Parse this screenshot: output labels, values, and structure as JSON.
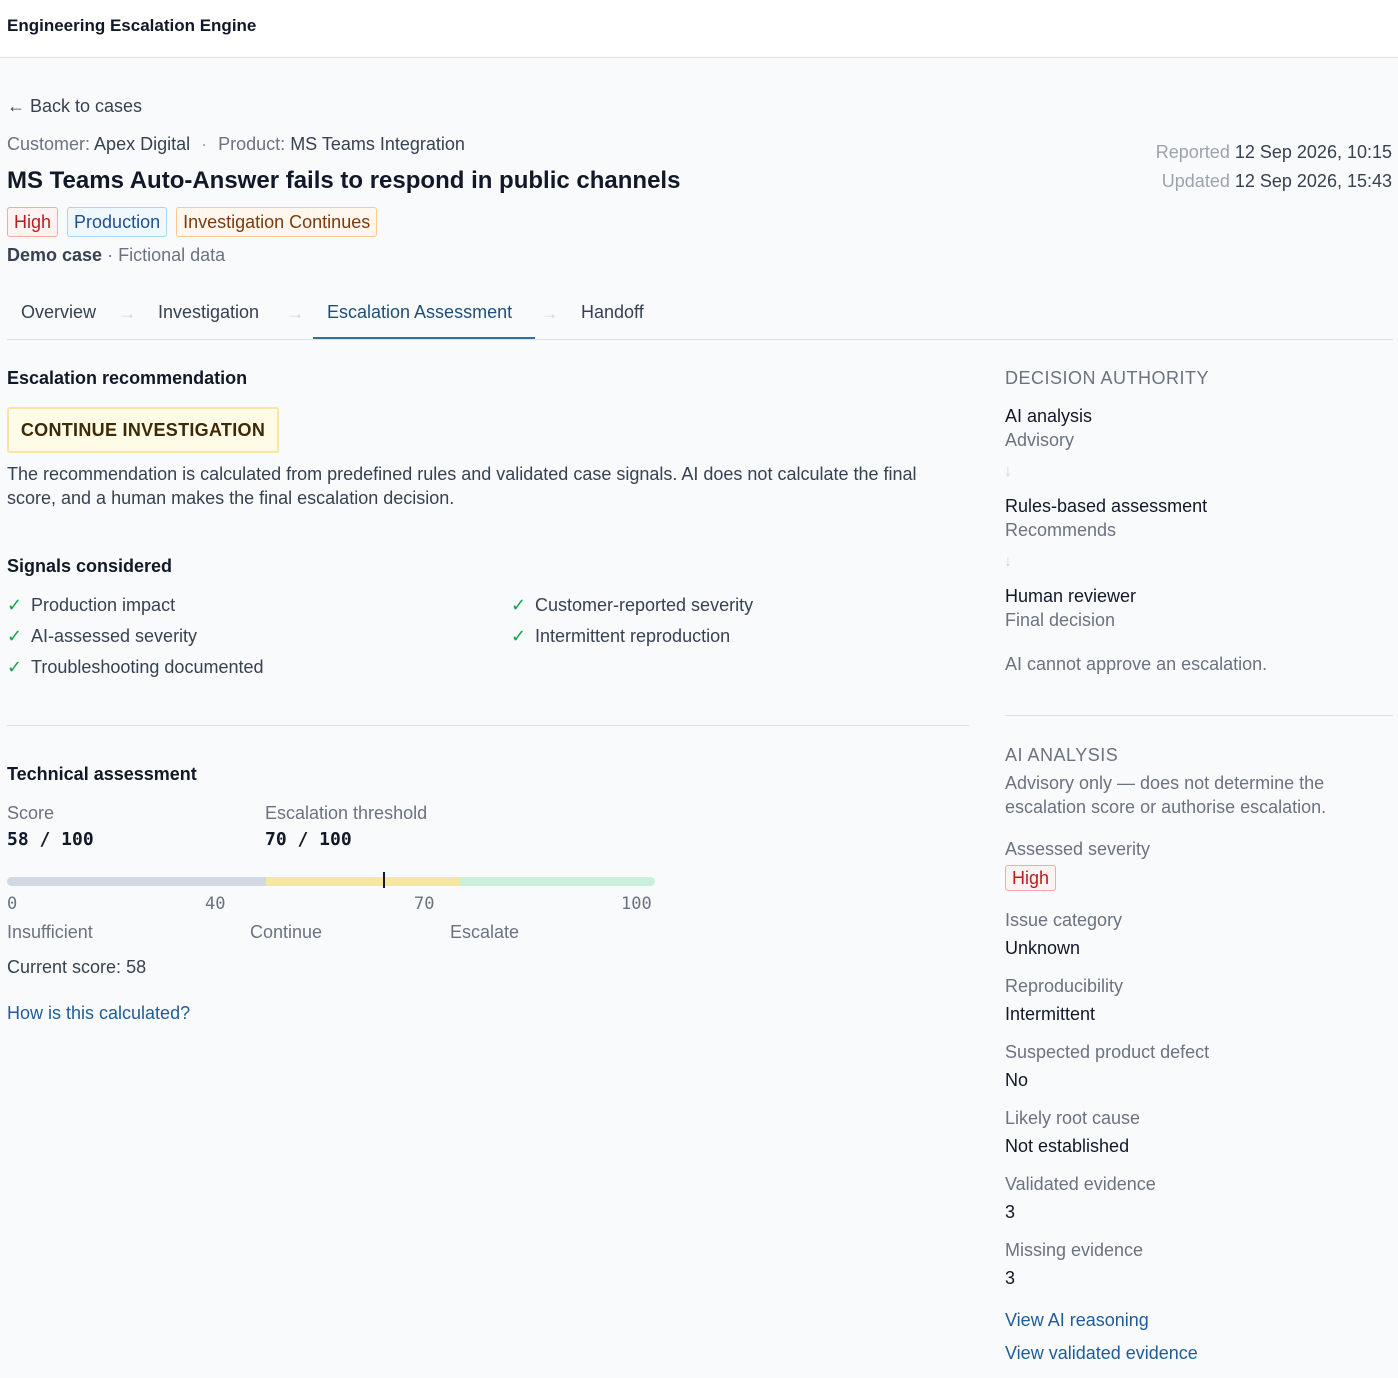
{
  "app": {
    "title": "Engineering Escalation Engine"
  },
  "nav": {
    "back_label": "← Back to cases"
  },
  "case": {
    "customer_label": "Customer:",
    "customer": "Apex Digital",
    "separator": "·",
    "product_label": "Product:",
    "product": "MS Teams Integration",
    "title": "MS Teams Auto-Answer fails to respond in public channels",
    "badges": {
      "severity": "High",
      "environment": "Production",
      "status": "Investigation Continues"
    },
    "demo_label": "Demo case",
    "demo_note": "· Fictional data",
    "reported_label": "Reported",
    "reported_value": "12 Sep 2026, 10:15",
    "updated_label": "Updated",
    "updated_value": "12 Sep 2026, 15:43"
  },
  "tabs": [
    {
      "label": "Overview"
    },
    {
      "label": "Investigation"
    },
    {
      "label": "Escalation Assessment"
    },
    {
      "label": "Handoff"
    }
  ],
  "tab_arrow": "→",
  "active_tab": "Escalation Assessment",
  "recommendation": {
    "heading": "Escalation recommendation",
    "verdict": "CONTINUE INVESTIGATION",
    "description": "The recommendation is calculated from predefined rules and validated case signals. AI does not calculate the final score, and a human makes the final escalation decision."
  },
  "signals": {
    "heading": "Signals considered",
    "check": "✓",
    "items": [
      "Production impact",
      "Customer-reported severity",
      "AI-assessed severity",
      "Intermittent reproduction",
      "Troubleshooting documented"
    ]
  },
  "technical": {
    "heading": "Technical assessment",
    "score_label": "Score",
    "score_value": "58 / 100",
    "threshold_label": "Escalation threshold",
    "threshold_value": "70 / 100",
    "score": 58,
    "scale_ticks": [
      "0",
      "40",
      "70",
      "100"
    ],
    "zones": [
      "Insufficient",
      "Continue",
      "Escalate"
    ],
    "current_label": "Current score:",
    "current_value": "58",
    "help_link": "How is this calculated?"
  },
  "decision_authority": {
    "heading": "DECISION AUTHORITY",
    "arrow": "↓",
    "steps": [
      {
        "title": "AI analysis",
        "role": "Advisory"
      },
      {
        "title": "Rules-based assessment",
        "role": "Recommends"
      },
      {
        "title": "Human reviewer",
        "role": "Final decision"
      }
    ],
    "note": "AI cannot approve an escalation."
  },
  "ai_analysis": {
    "heading": "AI ANALYSIS",
    "note_line1": "Advisory only — does not determine the",
    "note_line2": "escalation score or authorise escalation.",
    "severity_label": "Assessed severity",
    "severity_value": "High",
    "fields": [
      {
        "label": "Issue category",
        "value": "Unknown"
      },
      {
        "label": "Reproducibility",
        "value": "Intermittent"
      },
      {
        "label": "Suspected product defect",
        "value": "No"
      },
      {
        "label": "Likely root cause",
        "value": "Not established"
      },
      {
        "label": "Validated evidence",
        "value": "3"
      },
      {
        "label": "Missing evidence",
        "value": "3"
      }
    ],
    "links": [
      "View AI reasoning",
      "View validated evidence"
    ]
  }
}
